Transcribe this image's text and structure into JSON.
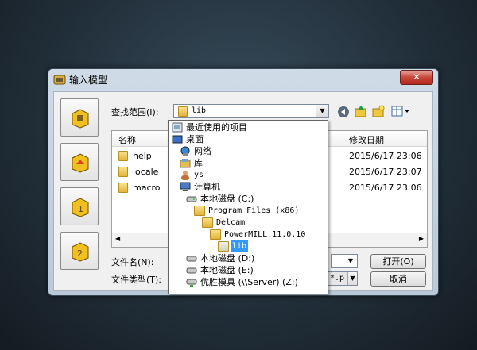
{
  "dialog": {
    "title": "输入模型",
    "close_symbol": "✕",
    "look_in_label": "查找范围(I):",
    "look_in_value": "lib",
    "columns": {
      "name": "名称",
      "modified": "修改日期"
    },
    "files": [
      {
        "name": "help",
        "modified": "2015/6/17 23:06"
      },
      {
        "name": "locale",
        "modified": "2015/6/17 23:07"
      },
      {
        "name": "macro",
        "modified": "2015/6/17 23:06"
      }
    ],
    "filename_label": "文件名(N):",
    "filename_value": "",
    "filetype_label": "文件类型(T):",
    "filetype_value": "*.p",
    "open_button": "打开(O)",
    "cancel_button": "取消",
    "dropdown_items": [
      {
        "label": "最近使用的项目",
        "icon": "recent-icon"
      },
      {
        "label": "桌面",
        "icon": "desktop-icon"
      },
      {
        "label": "网络",
        "icon": "network-icon"
      },
      {
        "label": "库",
        "icon": "library-icon"
      },
      {
        "label": "ys",
        "icon": "user-icon"
      },
      {
        "label": "计算机",
        "icon": "computer-icon"
      },
      {
        "label": "本地磁盘 (C:)",
        "icon": "drive-icon"
      },
      {
        "label": "Program Files (x86)",
        "icon": "folder-icon"
      },
      {
        "label": "Delcam",
        "icon": "folder-icon"
      },
      {
        "label": "PowerMILL 11.0.10",
        "icon": "folder-icon"
      },
      {
        "label": "lib",
        "icon": "folder-open-icon"
      },
      {
        "label": "本地磁盘 (D:)",
        "icon": "drive-icon"
      },
      {
        "label": "本地磁盘 (E:)",
        "icon": "drive-icon"
      },
      {
        "label": "优胜模具 (\\\\Server) (Z:)",
        "icon": "network-drive-icon"
      }
    ]
  }
}
